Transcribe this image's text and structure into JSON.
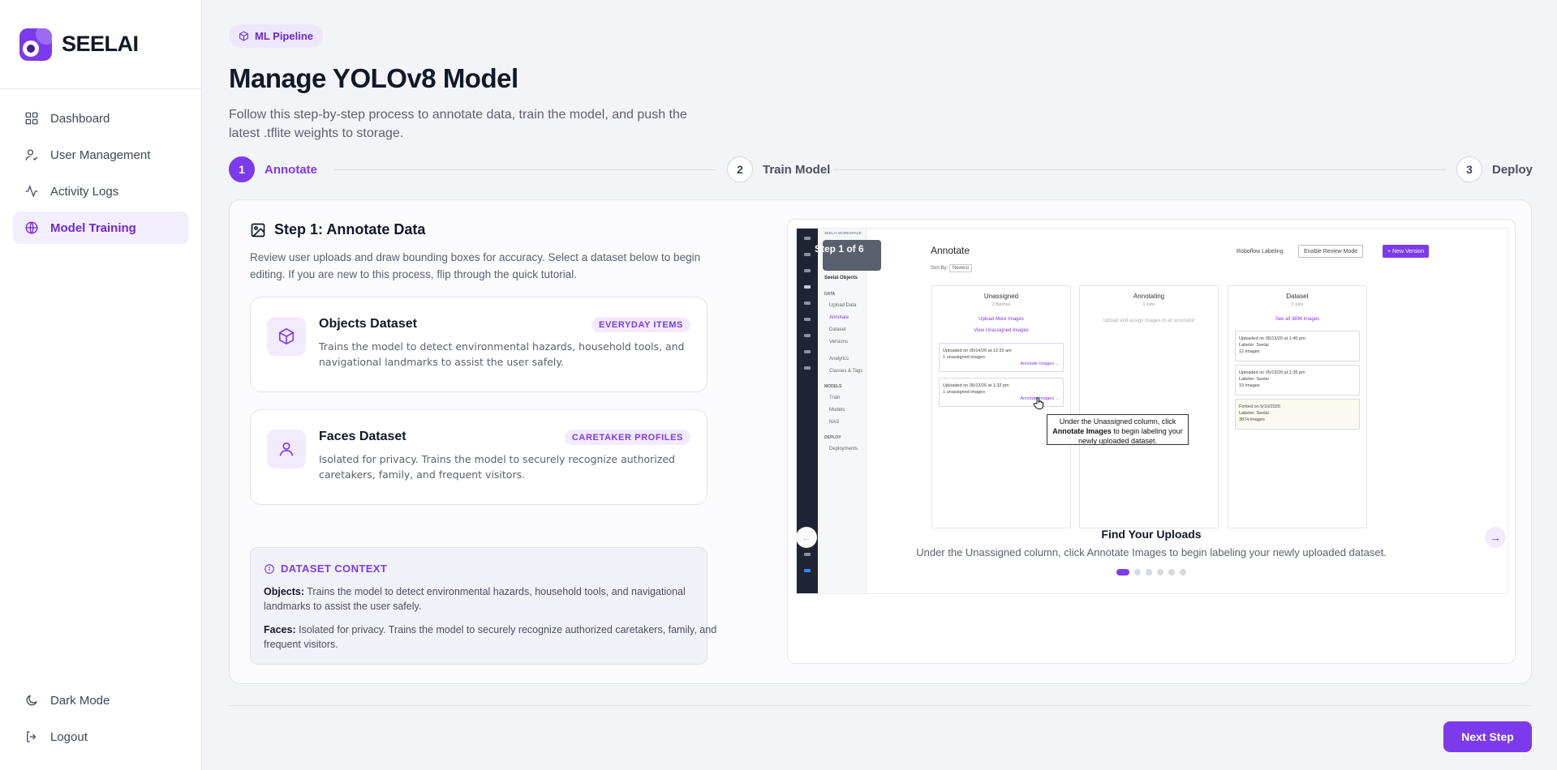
{
  "brand": {
    "name": "SEELAI",
    "accent": "#7c3aed"
  },
  "sidebar": {
    "items": [
      {
        "label": "Dashboard",
        "icon": "grid-icon"
      },
      {
        "label": "User Management",
        "icon": "user-icon"
      },
      {
        "label": "Activity Logs",
        "icon": "activity-icon"
      },
      {
        "label": "Model Training",
        "icon": "globe-icon",
        "active": true
      }
    ],
    "bottom": [
      {
        "label": "Dark Mode",
        "icon": "moon-icon"
      },
      {
        "label": "Logout",
        "icon": "logout-icon"
      }
    ]
  },
  "header": {
    "pill": "ML Pipeline",
    "title": "Manage YOLOv8 Model",
    "subtitle": "Follow this step-by-step process to annotate data, train the model, and push the latest .tflite weights to storage."
  },
  "stepper": [
    {
      "num": "1",
      "label": "Annotate",
      "active": true
    },
    {
      "num": "2",
      "label": "Train Model"
    },
    {
      "num": "3",
      "label": "Deploy"
    }
  ],
  "step1": {
    "title": "Step 1: Annotate Data",
    "description": "Review user uploads and draw bounding boxes for accuracy. Select a dataset below to begin editing. If you are new to this process, flip through the quick tutorial.",
    "datasets": [
      {
        "name": "Objects Dataset",
        "tag": "EVERYDAY ITEMS",
        "description": "Trains the model to detect environmental hazards, household tools, and navigational landmarks to assist the user safely.",
        "icon": "cube-icon"
      },
      {
        "name": "Faces Dataset",
        "tag": "CARETAKER PROFILES",
        "description": "Isolated for privacy. Trains the model to securely recognize authorized caretakers, family, and frequent visitors.",
        "icon": "person-icon"
      }
    ],
    "context": {
      "heading": "DATASET CONTEXT",
      "objects_label": "Objects:",
      "objects_text": "Trains the model to detect environmental hazards, household tools, and navigational landmarks to assist the user safely.",
      "faces_label": "Faces:",
      "faces_text": "Isolated for privacy. Trains the model to securely recognize authorized caretakers, family, and frequent visitors."
    }
  },
  "tutorial": {
    "step_counter": "Step 1 of 6",
    "screenshot": {
      "workspace": "SEELAI WORKSPACE",
      "project": "Seelai Objects",
      "nav_data": "DATA",
      "nav_items": [
        "Upload Data",
        "Annotate",
        "Dataset",
        "Versions",
        "Analytics",
        "Classes & Tags"
      ],
      "nav_models": "MODELS",
      "nav_model_items": [
        "Train",
        "Models",
        "NAS"
      ],
      "nav_deploy": "DEPLOY",
      "nav_deploy_items": [
        "Deployments"
      ],
      "title": "Annotate",
      "sort_label": "Sort By:",
      "sort_value": "Newest",
      "roboflow": "Roboflow Labeling",
      "review_btn": "Enable Review Mode",
      "new_version_btn": "+ New Version",
      "columns": [
        {
          "title": "Unassigned",
          "sub": "2 Batches"
        },
        {
          "title": "Annotating",
          "sub": "0 Jobs"
        },
        {
          "title": "Dataset",
          "sub": "3 Jobs"
        }
      ],
      "upload_more": "Upload More Images",
      "view_unassigned": "View Unassigned Images",
      "annotating_hint": "Upload and assign images to an annotator",
      "see_all": "See all 3896 images",
      "unassigned_cards": [
        {
          "line1": "Uploaded on 05/14/26 at 12:33 am",
          "line2": "1 unassigned images",
          "link": "Annotate Images →"
        },
        {
          "line1": "Uploaded on 05/13/26 at 1:32 pm",
          "line2": "1 unassigned images",
          "link": "Annotate Images →"
        }
      ],
      "dataset_cards": [
        {
          "line1": "Uploaded on 05/13/26 at 1:40 pm",
          "line2": "Labeler: Seelai",
          "line3": "12 Images"
        },
        {
          "line1": "Uploaded on 05/13/26 at 1:35 pm",
          "line2": "Labeler: Seelai",
          "line3": "10 Images"
        },
        {
          "line1": "Forked on 5/10/2026",
          "line2": "Labeler: Seelai",
          "line3": "3874 Images"
        }
      ],
      "tooltip_pre": "Under the Unassigned column, click ",
      "tooltip_bold": "Annotate Images",
      "tooltip_post": " to begin labeling your newly uploaded dataset."
    },
    "feature_title": "Find Your Uploads",
    "feature_desc": "Under the Unassigned column, click Annotate Images to begin labeling your newly uploaded dataset.",
    "prev": "←",
    "next": "→",
    "total_slides": 6,
    "current_slide": 1
  },
  "footer": {
    "next_label": "Next Step"
  }
}
